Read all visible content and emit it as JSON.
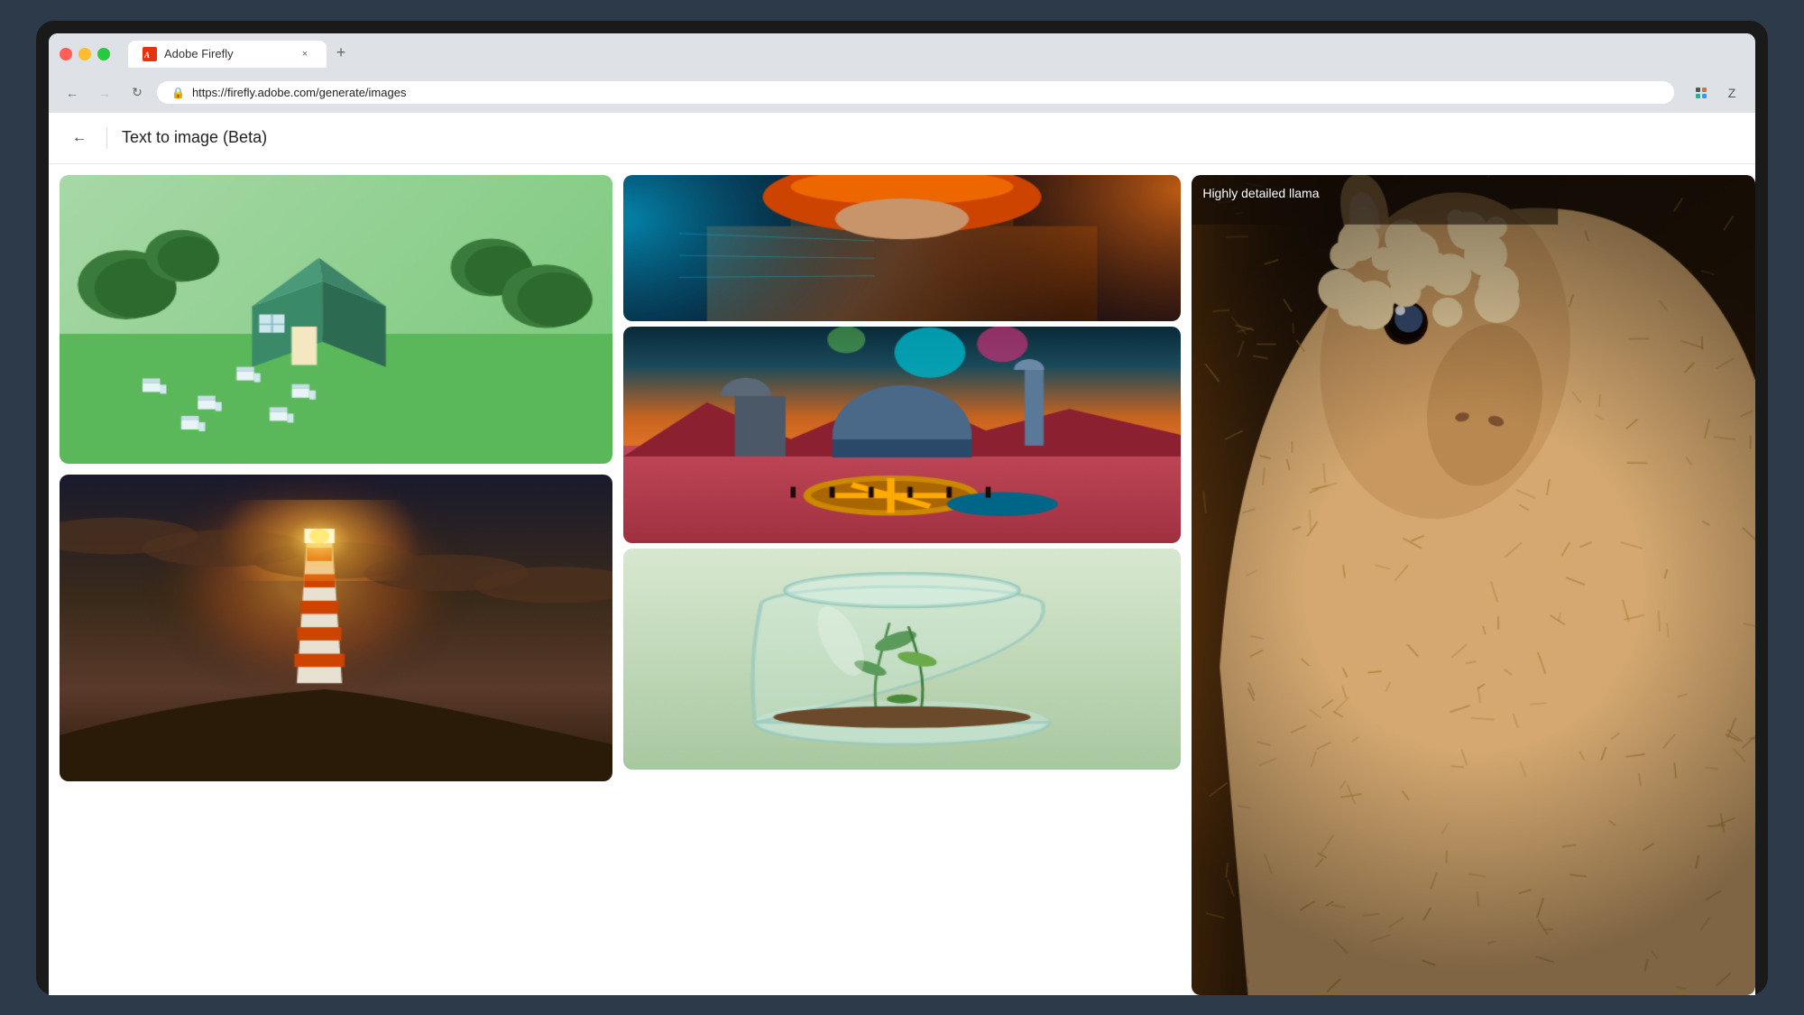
{
  "browser": {
    "tab": {
      "favicon_text": "Ai",
      "title": "Adobe Firefly",
      "close_btn": "×",
      "new_tab_btn": "+"
    },
    "address": "https://firefly.adobe.com/generate/images",
    "nav": {
      "back_disabled": false,
      "forward_disabled": true,
      "reload": "↻"
    }
  },
  "page": {
    "back_btn": "←",
    "title": "Text to image (Beta)"
  },
  "gallery": {
    "images": [
      {
        "id": "house",
        "alt": "3D isometric green house with trees",
        "label": ""
      },
      {
        "id": "lighthouse",
        "alt": "Dramatic lighthouse at sunset",
        "label": ""
      },
      {
        "id": "cyberpunk",
        "alt": "Cyberpunk character with neon lights",
        "label": ""
      },
      {
        "id": "alien-city",
        "alt": "Alien retro-futuristic city landscape",
        "label": ""
      },
      {
        "id": "jar",
        "alt": "Glass jar with plants inside",
        "label": ""
      },
      {
        "id": "llama",
        "alt": "Highly detailed llama",
        "label": "Highly detailed llama"
      }
    ]
  }
}
